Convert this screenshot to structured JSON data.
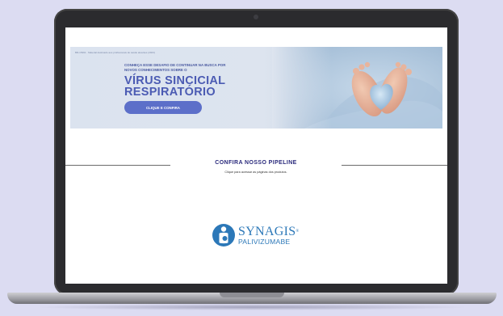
{
  "banner": {
    "note": "BR-15391 · Material destinado aos profissionais de saúde atuantes (2023)",
    "kicker": "CONHEÇA ESSE DESAFIO DE CONTINUAR NA BUSCA POR NOVOS CONHECIMENTOS SOBRE O",
    "title": "VÍRUS SINCICIAL RESPIRATÓRIO",
    "button_label": "CLIQUE E CONFIRA"
  },
  "pipeline": {
    "heading": "CONFIRA NOSSO PIPELINE",
    "subheading": "Clique para acessar as páginas dos produtos."
  },
  "product_logo": {
    "name": "SYNAGIS",
    "trademark": "®",
    "generic": "PALIVIZUMABE",
    "icon": "synagis-logo-icon"
  },
  "colors": {
    "brand_blue": "#2c78b8",
    "title_blue": "#4b5bb3",
    "button_blue": "#5c6fc9",
    "heading_navy": "#2a2a7c",
    "page_background": "#dcdcf2"
  }
}
